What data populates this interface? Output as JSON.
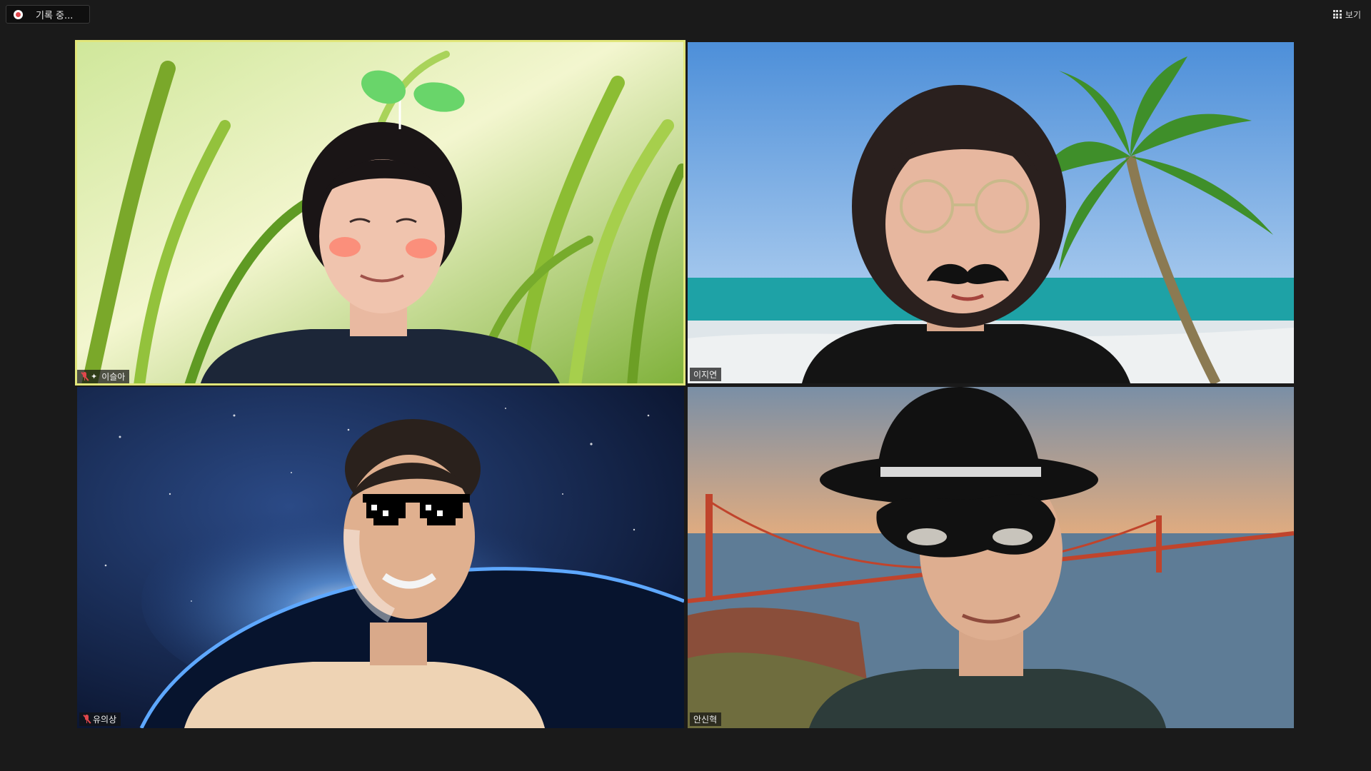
{
  "toolbar": {
    "recording_label": "기록 중...",
    "recording_icon": "record-icon",
    "view_label": "보기",
    "view_icon": "grid-icon"
  },
  "participants": [
    {
      "name": "이슬아",
      "muted": true,
      "pinned": true,
      "active_speaker": true,
      "background": "grass",
      "filter": "sprout-headband"
    },
    {
      "name": "이지연",
      "muted": false,
      "pinned": false,
      "active_speaker": false,
      "background": "tropical-beach",
      "filter": "mustache-glasses"
    },
    {
      "name": "유의상",
      "muted": true,
      "pinned": false,
      "active_speaker": false,
      "background": "earth-from-space",
      "filter": "pixel-sunglasses"
    },
    {
      "name": "안신혁",
      "muted": false,
      "pinned": false,
      "active_speaker": false,
      "background": "golden-gate-bridge",
      "filter": "fedora-mask"
    }
  ],
  "colors": {
    "app_background": "#1a1a1a",
    "active_speaker_border": "#e1e67a",
    "muted_red": "#e0474c"
  }
}
